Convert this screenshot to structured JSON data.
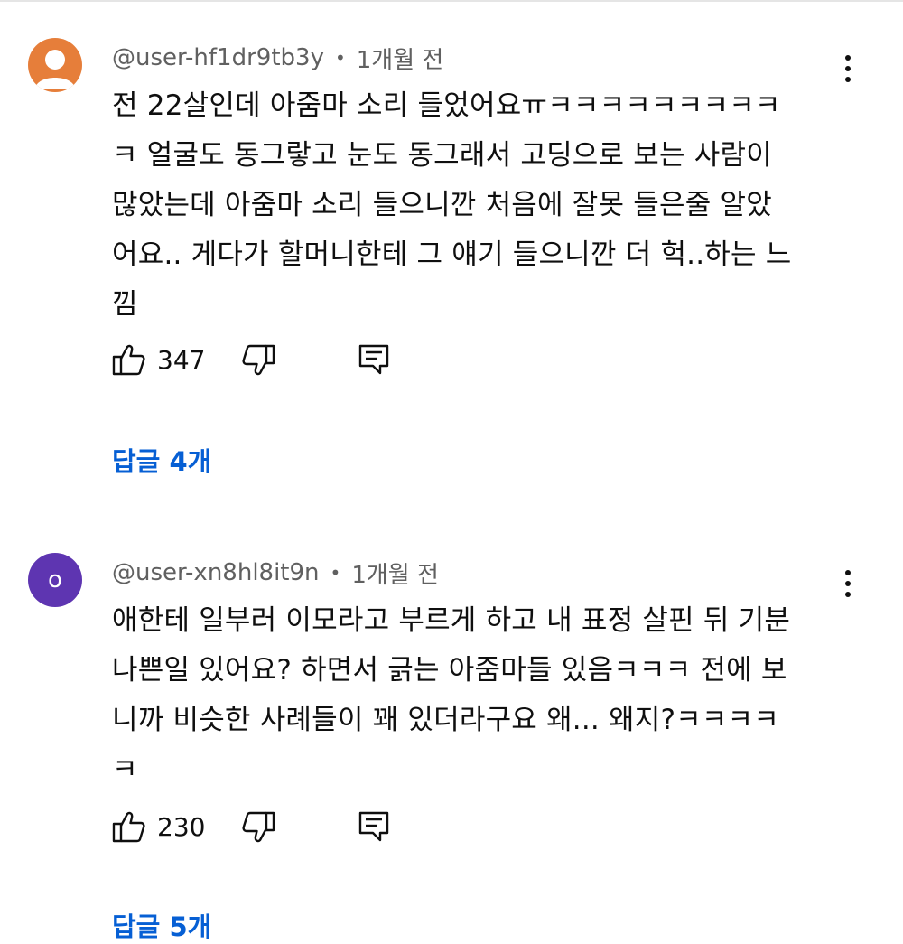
{
  "comments": [
    {
      "author": "@user-hf1dr9tb3y",
      "time": "1개월 전",
      "avatar_color": "#e67e3a",
      "avatar_icon": "person-icon",
      "text": "전 22살인데 아줌마 소리 들었어요ㅠㅋㅋㅋㅋㅋㅋㅋㅋㅋ\nㅋ 얼굴도 동그랗고 눈도 동그래서 고딩으로 보는 사람이\n많았는데 아줌마 소리 들으니깐 처음에 잘못 들은줄 알았\n어요.. 게다가 할머니한테 그 얘기 들으니깐 더 헉..하는 느\n낌",
      "likes": "347",
      "replies_label": "답글 4개"
    },
    {
      "author": "@user-xn8hl8it9n",
      "time": "1개월 전",
      "avatar_color": "#5e35b1",
      "avatar_letter": "o",
      "text": "애한테 일부러 이모라고 부르게 하고 내 표정 살핀 뒤 기분\n나쁜일 있어요? 하면서 긁는 아줌마들 있음ㅋㅋㅋ 전에 보\n니까 비슷한 사례들이 꽤 있더라구요 왜... 왜지?ㅋㅋㅋㅋ\nㅋ",
      "likes": "230",
      "replies_label": "답글 5개"
    }
  ],
  "icons": {
    "like": "thumbs-up-icon",
    "dislike": "thumbs-down-icon",
    "reply": "reply-comment-icon",
    "menu": "more-vertical-icon"
  },
  "colors": {
    "link": "#065fd4",
    "meta": "#606060",
    "text": "#0f0f0f"
  }
}
